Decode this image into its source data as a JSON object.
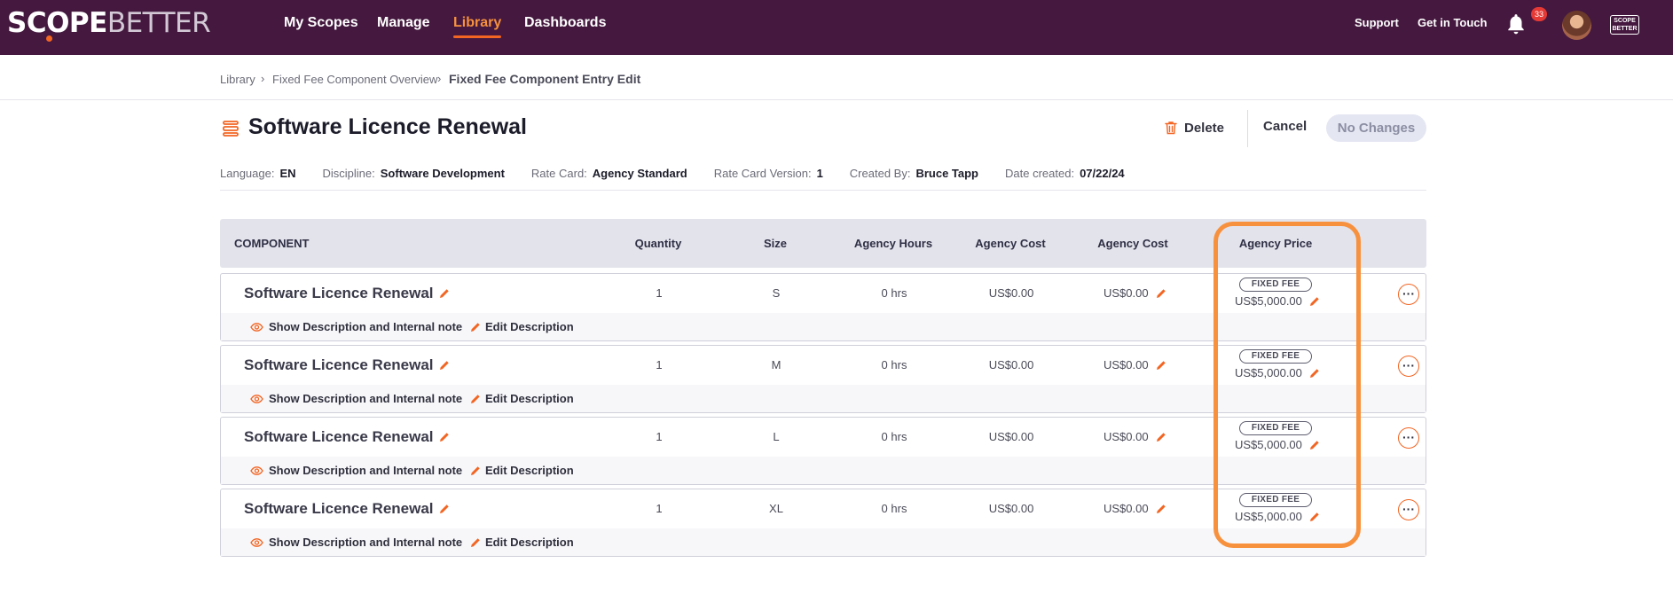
{
  "nav": {
    "logo_primary": "SCOPE",
    "logo_secondary": "BETTER",
    "links": [
      "My Scopes",
      "Manage",
      "Library",
      "Dashboards"
    ],
    "active_link": "Library",
    "support": "Support",
    "get_in_touch": "Get in Touch",
    "notification_count": "33",
    "mini_logo": "SCOPE BETTER"
  },
  "breadcrumb": {
    "items": [
      "Library",
      "Fixed Fee Component Overview"
    ],
    "current": "Fixed Fee Component Entry Edit",
    "separator": "›"
  },
  "header": {
    "title": "Software Licence Renewal",
    "delete_label": "Delete",
    "cancel_label": "Cancel",
    "save_label": "No Changes"
  },
  "meta": {
    "language_label": "Language:",
    "language": "EN",
    "discipline_label": "Discipline:",
    "discipline": "Software Development",
    "rate_card_label": "Rate Card:",
    "rate_card": "Agency Standard",
    "rate_card_version_label": "Rate Card Version:",
    "rate_card_version": "1",
    "created_by_label": "Created By:",
    "created_by": "Bruce Tapp",
    "date_created_label": "Date created:",
    "date_created": "07/22/24"
  },
  "table": {
    "headers": {
      "component": "COMPONENT",
      "quantity": "Quantity",
      "size": "Size",
      "agency_hours": "Agency Hours",
      "agency_cost_1": "Agency Cost",
      "agency_cost_2": "Agency Cost",
      "agency_price": "Agency Price"
    },
    "show_desc_label": "Show Description and Internal note",
    "edit_desc_label": "Edit Description",
    "fixed_fee_label": "FIXED FEE",
    "rows": [
      {
        "name": "Software Licence Renewal",
        "quantity": "1",
        "size": "S",
        "hours": "0 hrs",
        "cost": "US$0.00",
        "cost2": "US$0.00",
        "price": "US$5,000.00"
      },
      {
        "name": "Software Licence Renewal",
        "quantity": "1",
        "size": "M",
        "hours": "0 hrs",
        "cost": "US$0.00",
        "cost2": "US$0.00",
        "price": "US$5,000.00"
      },
      {
        "name": "Software Licence Renewal",
        "quantity": "1",
        "size": "L",
        "hours": "0 hrs",
        "cost": "US$0.00",
        "cost2": "US$0.00",
        "price": "US$5,000.00"
      },
      {
        "name": "Software Licence Renewal",
        "quantity": "1",
        "size": "XL",
        "hours": "0 hrs",
        "cost": "US$0.00",
        "cost2": "US$0.00",
        "price": "US$5,000.00"
      }
    ]
  },
  "colors": {
    "nav_bg": "#45193f",
    "accent": "#f26522",
    "highlight": "#f7913d"
  }
}
